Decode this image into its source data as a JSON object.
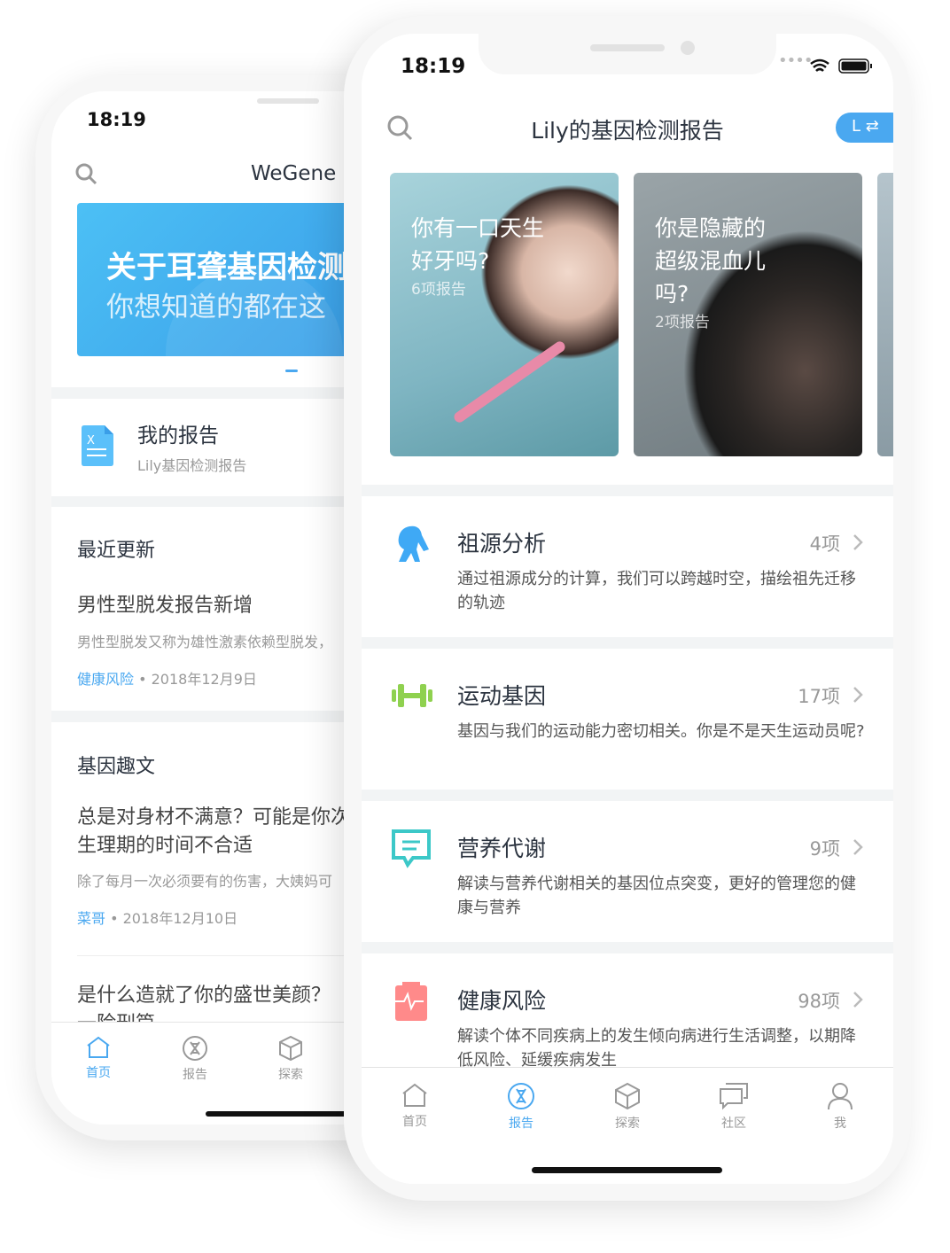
{
  "back_phone": {
    "time": "18:19",
    "brand": "WeGene",
    "banner": {
      "title": "关于耳聋基因检测",
      "subtitle": "你想知道的都在这"
    },
    "my_report": {
      "title": "我的报告",
      "subtitle": "Lily基因检测报告",
      "icon": "document-icon"
    },
    "recent": {
      "heading": "最近更新",
      "title": "男性型脱发报告新增",
      "excerpt": "男性型脱发又称为雄性激素依赖型脱发，",
      "tag": "健康风险",
      "date": "2018年12月9日"
    },
    "fun": {
      "heading": "基因趣文",
      "title": "总是对身材不满意？可能是你次生理期的时间不合适",
      "excerpt": "除了每月一次必须要有的伤害，大姨妈可",
      "tag": "菜哥",
      "date": "2018年12月10日",
      "next_title": "是什么造就了你的盛世美颜？一险刑篇"
    },
    "tabs": [
      {
        "label": "首页",
        "icon": "home-icon",
        "active": true
      },
      {
        "label": "报告",
        "icon": "dna-icon"
      },
      {
        "label": "探索",
        "icon": "cube-icon"
      }
    ]
  },
  "front_phone": {
    "time": "18:19",
    "title": "Lily的基因检测报告",
    "switch_label": "L ⇄",
    "cards": [
      {
        "title": "你有一口天生好牙吗?",
        "count": "6项报告"
      },
      {
        "title": "你是隐藏的超级混血儿吗?",
        "count": "2项报告"
      }
    ],
    "sections": [
      {
        "title": "祖源分析",
        "count": "4项",
        "desc": "通过祖源成分的计算，我们可以跨越时空，描绘祖先迁移的轨迹",
        "icon": "ape-icon",
        "color": "#3fa9f5"
      },
      {
        "title": "运动基因",
        "count": "17项",
        "desc": "基因与我们的运动能力密切相关。你是不是天生运动员呢?",
        "icon": "dumbbell-icon",
        "color": "#8fd14f"
      },
      {
        "title": "营养代谢",
        "count": "9项",
        "desc": "解读与营养代谢相关的基因位点突变，更好的管理您的健康与营养",
        "icon": "nutrition-icon",
        "color": "#3cc8c8"
      },
      {
        "title": "健康风险",
        "count": "98项",
        "desc": "解读个体不同疾病上的发生倾向病进行生活调整，以期降低风险、延缓疾病发生",
        "icon": "heartbeat-icon",
        "color": "#ff8a8a"
      }
    ],
    "tabs": [
      {
        "label": "首页",
        "icon": "home-icon"
      },
      {
        "label": "报告",
        "icon": "dna-icon",
        "active": true
      },
      {
        "label": "探索",
        "icon": "cube-icon"
      },
      {
        "label": "社区",
        "icon": "chat-icon"
      },
      {
        "label": "我",
        "icon": "user-icon"
      }
    ]
  },
  "colors": {
    "accent": "#4aa8f0",
    "text": "#2c3440",
    "muted": "#999999"
  }
}
